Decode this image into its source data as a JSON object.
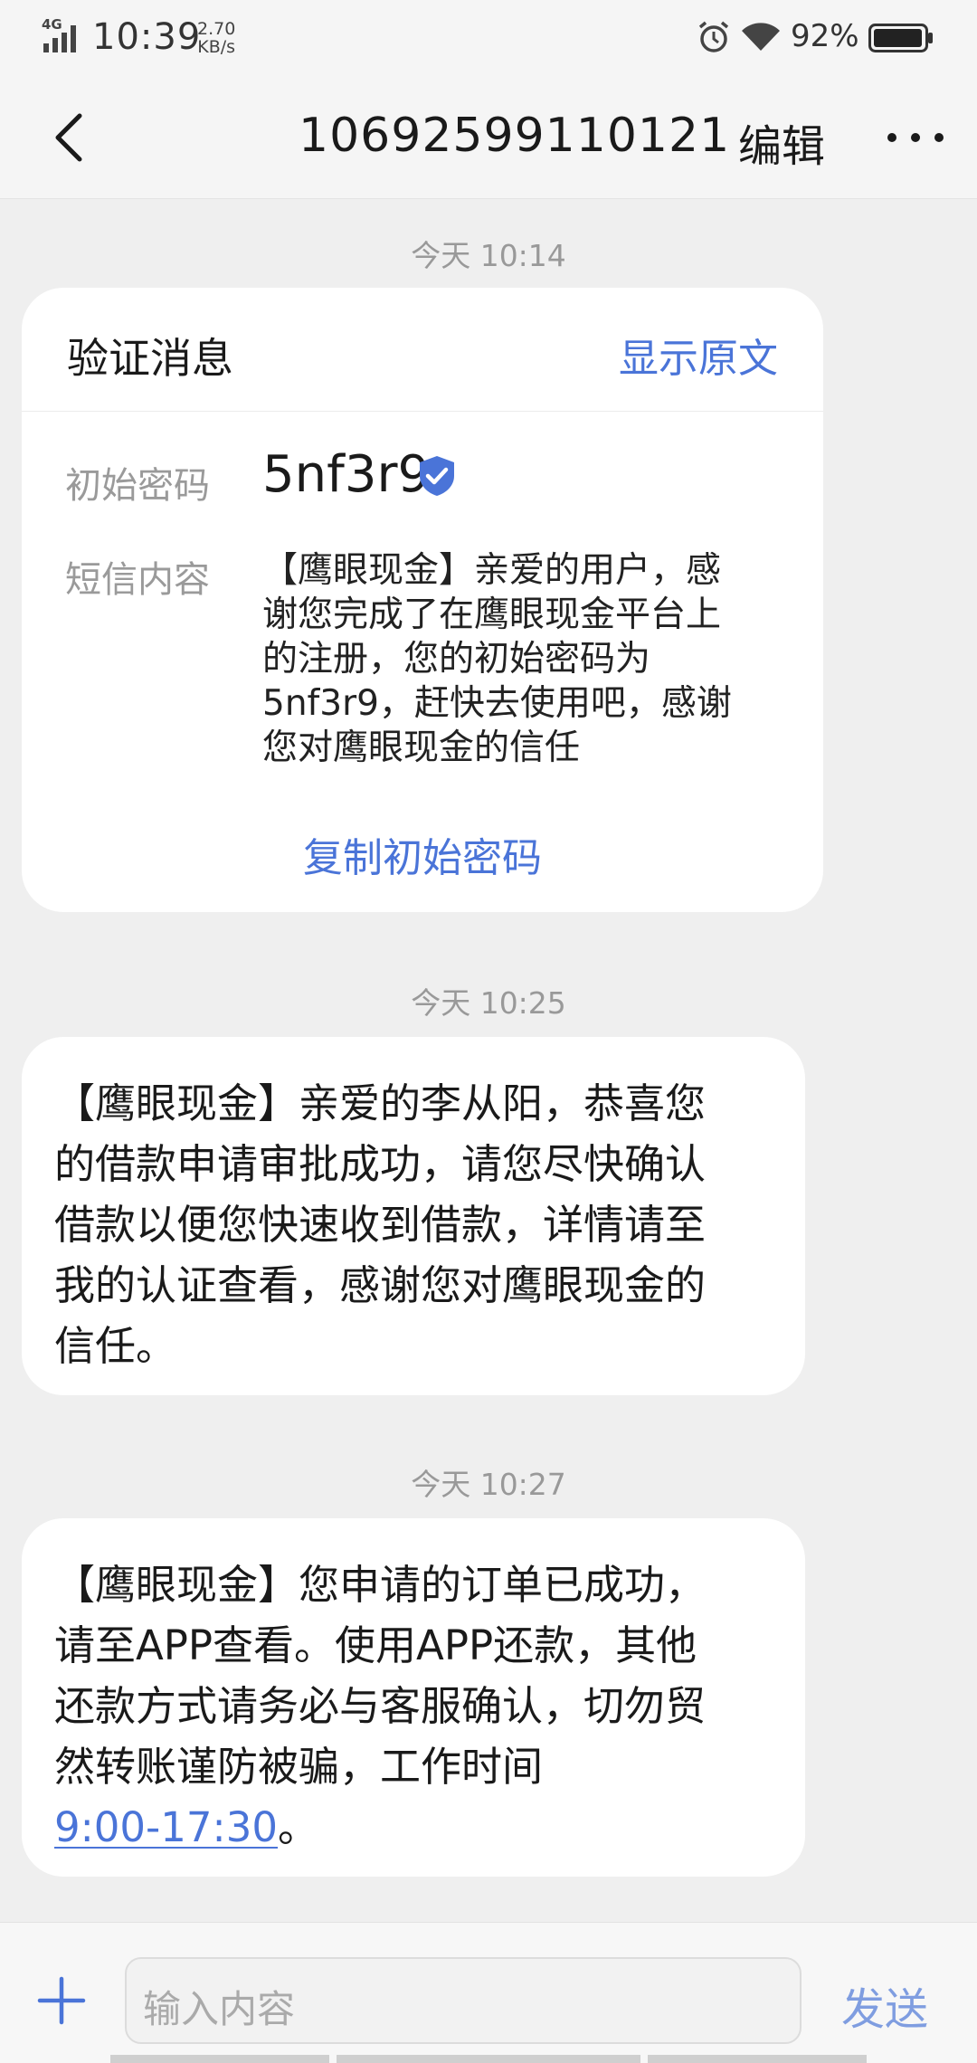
{
  "status": {
    "network": "4G",
    "time": "10:39",
    "speed_value": "2.70",
    "speed_unit": "KB/s",
    "battery": "92%",
    "icons": [
      "signal-icon",
      "alarm-icon",
      "wifi-icon",
      "battery-icon"
    ]
  },
  "header": {
    "title": "10692599110121",
    "edit": "编辑"
  },
  "messages": {
    "ts1": "今天 10:14",
    "card": {
      "heading": "验证消息",
      "show_original": "显示原文",
      "code_label": "初始密码",
      "code": "5nf3r9",
      "content_label": "短信内容",
      "content_lines": [
        "【鹰眼现金】亲爱的用户，感",
        "谢您完成了在鹰眼现金平台上",
        "的注册，您的初始密码为",
        "5nf3r9，赶快去使用吧，感谢",
        "您对鹰眼现金的信任"
      ],
      "copy": "复制初始密码"
    },
    "ts2": "今天 10:25",
    "msg2_lines": [
      "【鹰眼现金】亲爱的李从阳，恭喜您",
      "的借款申请审批成功，请您尽快确认",
      "借款以便您快速收到借款，详情请至",
      "我的认证查看，感谢您对鹰眼现金的",
      "信任。"
    ],
    "ts3": "今天 10:27",
    "msg3_lines": [
      "【鹰眼现金】您申请的订单已成功，",
      "请至APP查看。使用APP还款，其他",
      "还款方式请务必与客服确认，切勿贸",
      "然转账谨防被骗，工作时间"
    ],
    "msg3_link": "9:00-17:30",
    "msg3_end": "。"
  },
  "input": {
    "placeholder": "输入内容",
    "send": "发送"
  },
  "colors": {
    "accent": "#4a74d8",
    "background": "#efefef",
    "bubble": "#ffffff"
  }
}
